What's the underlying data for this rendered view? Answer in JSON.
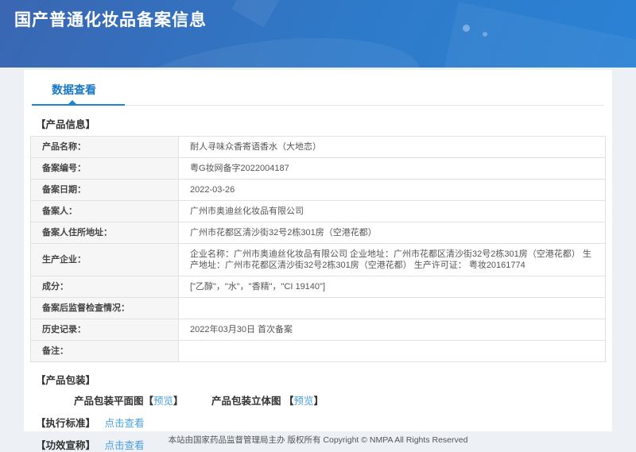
{
  "header": {
    "title": "国产普通化妆品备案信息"
  },
  "tab": {
    "label": "数据查看"
  },
  "product_info": {
    "section_title": "【产品信息】",
    "rows": [
      {
        "label": "产品名称：",
        "value": "耐人寻味众香寄语香水（大地恋）"
      },
      {
        "label": "备案编号：",
        "value": "粤G妆网备字2022004187"
      },
      {
        "label": "备案日期：",
        "value": "2022-03-26"
      },
      {
        "label": "备案人：",
        "value": "广州市奥迪丝化妆品有限公司"
      },
      {
        "label": "备案人住所地址：",
        "value": "广州市花都区清沙街32号2栋301房（空港花都）"
      },
      {
        "label": "生产企业：",
        "value": "企业名称：广州市奥迪丝化妆品有限公司 企业地址：广州市花都区清沙街32号2栋301房（空港花都） 生产地址：广州市花都区清沙街32号2栋301房（空港花都） 生产许可证： 粤妆20161774"
      },
      {
        "label": "成分：",
        "value": "[\"乙醇\"，\"水\"，\"香精\"，\"CI 19140\"]"
      },
      {
        "label": "备案后监督检查情况：",
        "value": ""
      },
      {
        "label": "历史记录：",
        "value": "2022年03月30日 首次备案"
      },
      {
        "label": "备注：",
        "value": ""
      }
    ]
  },
  "packaging": {
    "section_title": "【产品包装】",
    "flat": {
      "label": "产品包装平面图",
      "bracket_open": "【",
      "link": "预览",
      "bracket_close": "】"
    },
    "stereo": {
      "label": "产品包装立体图 ",
      "bracket_open": "【",
      "link": "预览",
      "bracket_close": "】"
    }
  },
  "standard": {
    "section_title": "【执行标准】",
    "link": "点击查看"
  },
  "efficacy": {
    "section_title": "【功效宣称】",
    "link": "点击查看"
  },
  "footer": {
    "copyright": "本站由国家药品监督管理局主办 版权所有 Copyright © NMPA All Rights Reserved"
  },
  "colors": {
    "accent_blue": "#1e83d2",
    "tab_text_blue": "#1778c5",
    "link_blue": "#4aa0e2",
    "header_gradient_start": "#3a66b2",
    "header_gradient_end": "#2b82d5",
    "label_cell_bg": "#f6f6f6",
    "page_bg": "#edf0f4"
  }
}
